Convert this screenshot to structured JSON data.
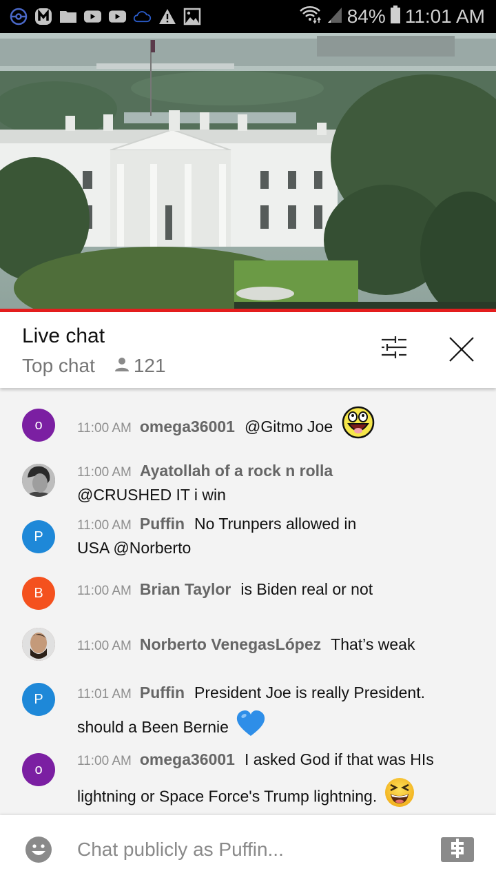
{
  "status_bar": {
    "notification_icons": [
      "pokeball-icon",
      "m-app-icon",
      "folder-icon",
      "youtube-icon",
      "youtube-icon",
      "cloud-icon",
      "warning-icon",
      "image-icon"
    ],
    "wifi_icon": "wifi-icon",
    "signal_icon": "signal-icon",
    "battery_percent": "84%",
    "battery_level": 0.84,
    "time": "11:01 AM"
  },
  "video": {
    "description": "Live stream view of the White House north facade",
    "progress_fraction": 1.0,
    "progress_color": "#e41e1e"
  },
  "header": {
    "title": "Live chat",
    "mode": "Top chat",
    "viewer_count": "121",
    "filter_icon": "tune-icon",
    "close_icon": "close-icon"
  },
  "messages": [
    {
      "avatar_type": "letter",
      "avatar_letter": "o",
      "avatar_color": "#7b1fa2",
      "time": "11:00 AM",
      "author": "omega36001",
      "text": "@Gitmo Joe",
      "emoji": "awesome-face"
    },
    {
      "avatar_type": "photo",
      "avatar_letter": "",
      "avatar_color": "#555555",
      "time": "11:00 AM",
      "author": "Ayatollah of a rock n rolla",
      "text": "@CRUSHED IT i win",
      "emoji": ""
    },
    {
      "avatar_type": "letter",
      "avatar_letter": "P",
      "avatar_color": "#1e88d8",
      "time": "11:00 AM",
      "author": "Puffin",
      "text": "No Trunpers allowed in USA @Norberto",
      "emoji": ""
    },
    {
      "avatar_type": "letter",
      "avatar_letter": "B",
      "avatar_color": "#f4511e",
      "time": "11:00 AM",
      "author": "Brian Taylor",
      "text": "is Biden real or not",
      "emoji": ""
    },
    {
      "avatar_type": "photo",
      "avatar_letter": "",
      "avatar_color": "#8d6e63",
      "time": "11:00 AM",
      "author": "Norberto VenegasLópez",
      "text": "That’s weak",
      "emoji": ""
    },
    {
      "avatar_type": "letter",
      "avatar_letter": "P",
      "avatar_color": "#1e88d8",
      "time": "11:01 AM",
      "author": "Puffin",
      "text": "President Joe is really President. should a Been Bernie",
      "emoji": "blue-heart"
    },
    {
      "avatar_type": "letter",
      "avatar_letter": "o",
      "avatar_color": "#7b1fa2",
      "time": "11:00 AM",
      "author": "omega36001",
      "text": "I asked God if that was HIs lightning or Space Force's Trump lightning.",
      "emoji": "laughing-face"
    }
  ],
  "input_bar": {
    "placeholder": "Chat publicly as Puffin...",
    "value": "",
    "emoji_icon": "smiley-icon",
    "superchat_icon": "dollar-icon"
  }
}
